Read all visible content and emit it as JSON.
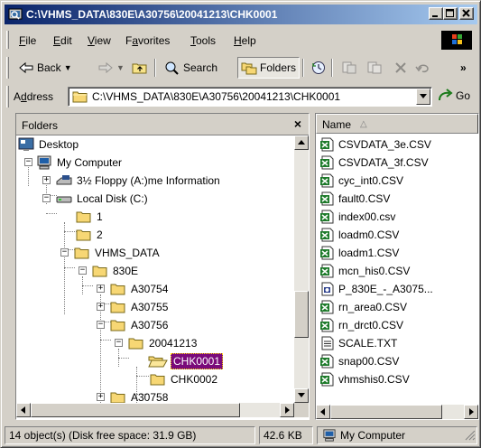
{
  "window": {
    "title": "C:\\VHMS_DATA\\830E\\A30756\\20041213\\CHK0001"
  },
  "menu": [
    {
      "pre": "",
      "acc": "F",
      "post": "ile"
    },
    {
      "pre": "",
      "acc": "E",
      "post": "dit"
    },
    {
      "pre": "",
      "acc": "V",
      "post": "iew"
    },
    {
      "pre": "F",
      "acc": "a",
      "post": "vorites"
    },
    {
      "pre": "",
      "acc": "T",
      "post": "ools"
    },
    {
      "pre": "",
      "acc": "H",
      "post": "elp"
    }
  ],
  "toolbar": {
    "back": "Back",
    "search": "Search",
    "folders": "Folders",
    "chevron": "»"
  },
  "address": {
    "label_pre": "A",
    "label_acc": "d",
    "label_post": "dress",
    "value": "C:\\VHMS_DATA\\830E\\A30756\\20041213\\CHK0001",
    "go": "Go"
  },
  "folders_pane": {
    "title": "Folders",
    "close": "×",
    "tree": [
      {
        "label": "Desktop",
        "icon": "desktop-icon"
      },
      {
        "label": "My Computer",
        "icon": "computer-icon",
        "toggle": "−"
      },
      {
        "label": "3½ Floppy (A:)me Information",
        "icon": "floppy-icon",
        "toggle": "+"
      },
      {
        "label": "Local Disk (C:)",
        "icon": "drive-icon",
        "toggle": "−"
      },
      {
        "label": "1",
        "icon": "folder-icon"
      },
      {
        "label": "2",
        "icon": "folder-icon"
      },
      {
        "label": "VHMS_DATA",
        "icon": "folder-icon",
        "toggle": "−"
      },
      {
        "label": "830E",
        "icon": "folder-icon",
        "toggle": "−"
      },
      {
        "label": "A30754",
        "icon": "folder-icon",
        "toggle": "+"
      },
      {
        "label": "A30755",
        "icon": "folder-icon",
        "toggle": "+"
      },
      {
        "label": "A30756",
        "icon": "folder-icon",
        "toggle": "−"
      },
      {
        "label": "20041213",
        "icon": "folder-icon",
        "toggle": "−"
      },
      {
        "label": "CHK0001",
        "icon": "open-folder-icon",
        "selected": true
      },
      {
        "label": "CHK0002",
        "icon": "folder-icon"
      },
      {
        "label": "A30758",
        "icon": "folder-icon",
        "toggle": "+"
      }
    ]
  },
  "files_pane": {
    "column": "Name",
    "sort_indicator": "△",
    "files": [
      {
        "name": "CSVDATA_3e.CSV",
        "icon": "excel-file-icon"
      },
      {
        "name": "CSVDATA_3f.CSV",
        "icon": "excel-file-icon"
      },
      {
        "name": "cyc_int0.CSV",
        "icon": "excel-file-icon"
      },
      {
        "name": "fault0.CSV",
        "icon": "excel-file-icon"
      },
      {
        "name": "index00.csv",
        "icon": "excel-file-icon"
      },
      {
        "name": "loadm0.CSV",
        "icon": "excel-file-icon"
      },
      {
        "name": "loadm1.CSV",
        "icon": "excel-file-icon"
      },
      {
        "name": "mcn_his0.CSV",
        "icon": "excel-file-icon"
      },
      {
        "name": "P_830E_-_A3075...",
        "icon": "document-icon"
      },
      {
        "name": "rn_area0.CSV",
        "icon": "excel-file-icon"
      },
      {
        "name": "rn_drct0.CSV",
        "icon": "excel-file-icon"
      },
      {
        "name": "SCALE.TXT",
        "icon": "text-file-icon"
      },
      {
        "name": "snap00.CSV",
        "icon": "excel-file-icon"
      },
      {
        "name": "vhmshis0.CSV",
        "icon": "excel-file-icon"
      }
    ]
  },
  "status": {
    "objects": "14 object(s) (Disk free space: 31.9 GB)",
    "size": "42.6 KB",
    "location": "My Computer"
  },
  "colors": {
    "title_start": "#0a246a",
    "title_end": "#a6caf0",
    "selection": "#7a0a7a",
    "chrome": "#d4d0c8"
  }
}
